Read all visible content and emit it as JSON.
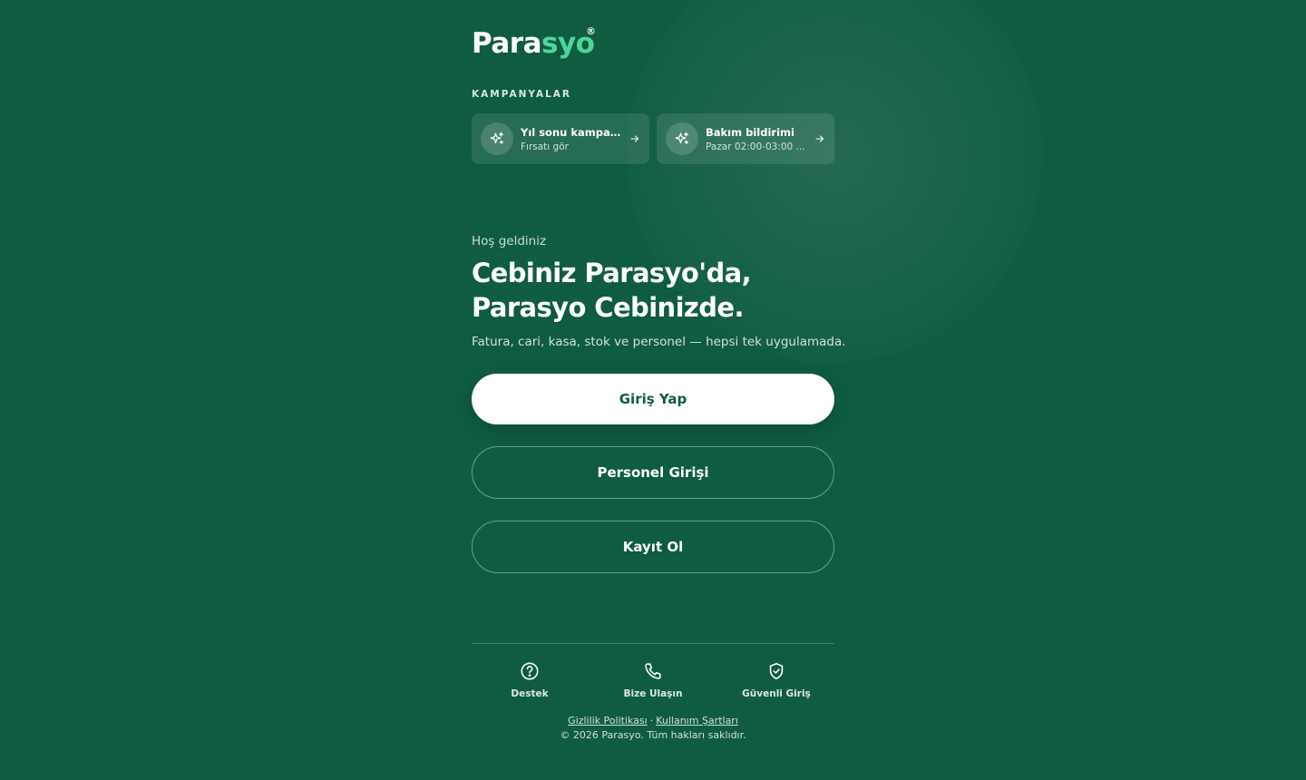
{
  "brand": {
    "name_part1": "Para",
    "name_part2": "syo",
    "registered": "®",
    "accent_color": "#4fd69a",
    "background_color": "#0f5c41"
  },
  "campaigns": {
    "section_label": "KAMPANYALAR",
    "items": [
      {
        "icon": "sparkles-icon",
        "title": "Yıl sonu kampany...",
        "subtitle": "Fırsatı gör"
      },
      {
        "icon": "sparkles-icon",
        "title": "Bakım bildirimi",
        "subtitle": "Pazar 02:00-03:00 ..."
      }
    ]
  },
  "hero": {
    "greeting": "Hoş geldiniz",
    "headline_line1": "Cebiniz Parasyo'da,",
    "headline_line2": "Parasyo Cebinizde.",
    "subtitle": "Fatura, cari, kasa, stok ve personel — hepsi tek uygulamada."
  },
  "actions": {
    "login": "Giriş Yap",
    "staff_login": "Personel Girişi",
    "register": "Kayıt Ol"
  },
  "footer": {
    "links": [
      {
        "icon": "help-circle-icon",
        "label": "Destek"
      },
      {
        "icon": "phone-icon",
        "label": "Bize Ulaşın"
      },
      {
        "icon": "shield-check-icon",
        "label": "Güvenli Giriş"
      }
    ],
    "privacy": "Gizlilik Politikası",
    "separator": "·",
    "terms": "Kullanım Şartları",
    "copyright": "© 2026 Parasyo. Tüm hakları saklıdır."
  }
}
